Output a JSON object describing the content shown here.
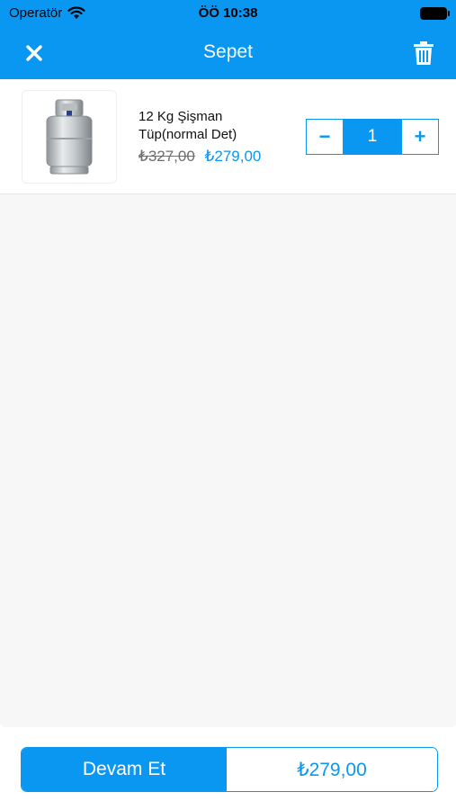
{
  "status_bar": {
    "carrier": "Operatör",
    "time": "ÖÖ 10:38"
  },
  "header": {
    "title": "Sepet",
    "close_icon": "close-icon",
    "trash_icon": "trash-icon"
  },
  "cart": {
    "items": [
      {
        "name": "12 Kg Şişman Tüp(normal Det)",
        "old_price": "₺327,00",
        "price": "₺279,00",
        "quantity": "1",
        "minus_label": "−",
        "plus_label": "+",
        "image": "gas-cylinder-image"
      }
    ]
  },
  "footer": {
    "checkout_label": "Devam Et",
    "total": "₺279,00"
  },
  "colors": {
    "accent": "#0a97f2",
    "background": "#f7f7f7"
  }
}
